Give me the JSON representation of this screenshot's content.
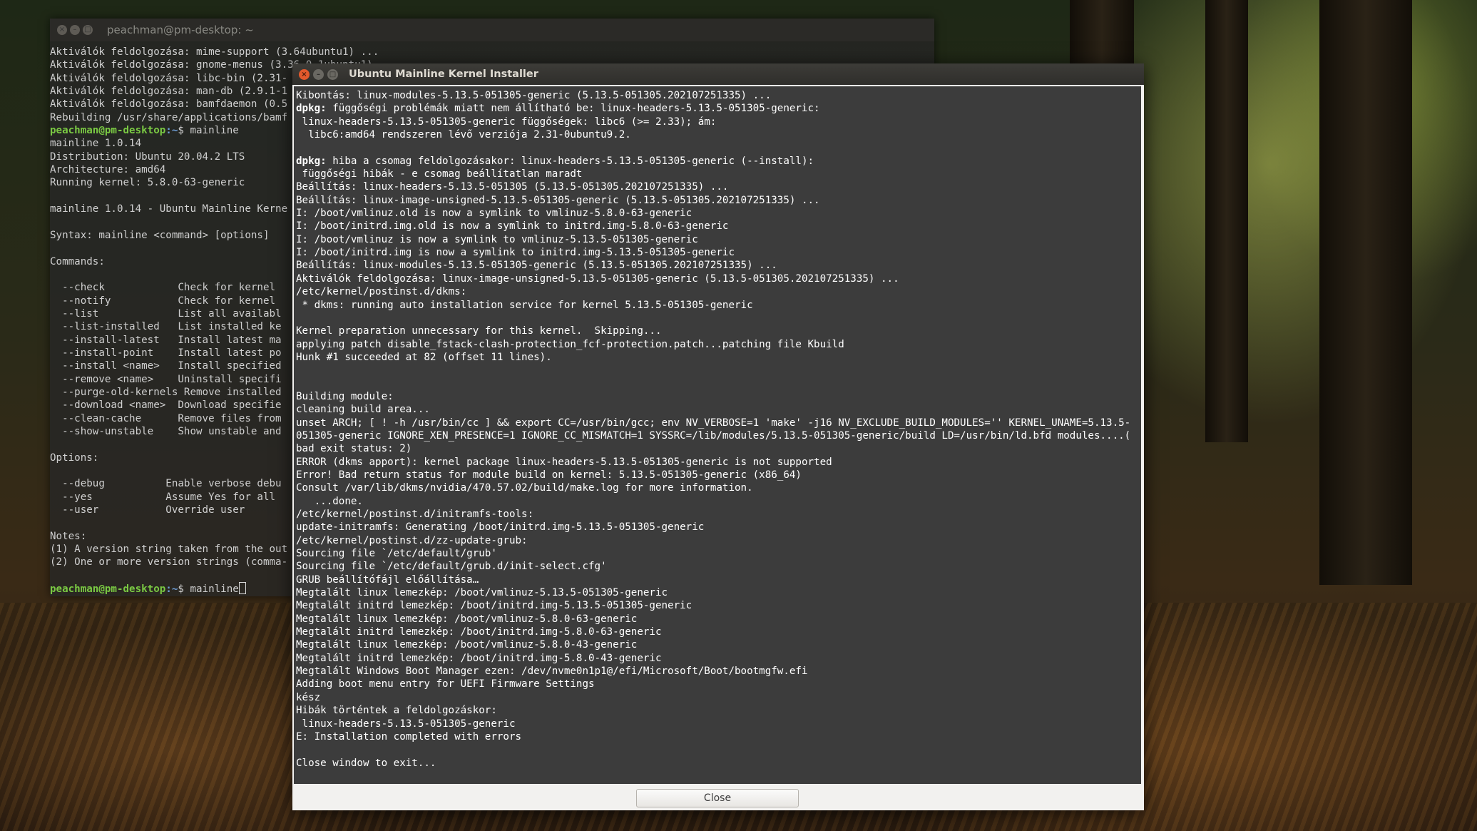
{
  "terminal": {
    "title": "peachman@pm-desktop: ~",
    "lines": [
      {
        "text": "Aktiválók feldolgozása: mime-support (3.64ubuntu1) ..."
      },
      {
        "text": "Aktiválók feldolgozása: gnome-menus (3.36.0-1ubuntu1) ..."
      },
      {
        "text": "Aktiválók feldolgozása: libc-bin (2.31-"
      },
      {
        "text": "Aktiválók feldolgozása: man-db (2.9.1-1"
      },
      {
        "text": "Aktiválók feldolgozása: bamfdaemon (0.5"
      },
      {
        "text": "Rebuilding /usr/share/applications/bamf"
      },
      {
        "user": "peachman@pm-desktop",
        "path": ":~",
        "text": "$ mainline"
      },
      {
        "text": "mainline 1.0.14"
      },
      {
        "text": "Distribution: Ubuntu 20.04.2 LTS"
      },
      {
        "text": "Architecture: amd64"
      },
      {
        "text": "Running kernel: 5.8.0-63-generic"
      },
      {
        "text": ""
      },
      {
        "text": "mainline 1.0.14 - Ubuntu Mainline Kerne"
      },
      {
        "text": ""
      },
      {
        "text": "Syntax: mainline <command> [options]"
      },
      {
        "text": ""
      },
      {
        "text": "Commands:"
      },
      {
        "text": ""
      },
      {
        "text": "  --check            Check for kernel"
      },
      {
        "text": "  --notify           Check for kernel"
      },
      {
        "text": "  --list             List all availabl"
      },
      {
        "text": "  --list-installed   List installed ke"
      },
      {
        "text": "  --install-latest   Install latest ma"
      },
      {
        "text": "  --install-point    Install latest po"
      },
      {
        "text": "  --install <name>   Install specified"
      },
      {
        "text": "  --remove <name>    Uninstall specifi"
      },
      {
        "text": "  --purge-old-kernels Remove installed"
      },
      {
        "text": "  --download <name>  Download specifie"
      },
      {
        "text": "  --clean-cache      Remove files from"
      },
      {
        "text": "  --show-unstable    Show unstable and"
      },
      {
        "text": ""
      },
      {
        "text": "Options:"
      },
      {
        "text": ""
      },
      {
        "text": "  --debug          Enable verbose debu"
      },
      {
        "text": "  --yes            Assume Yes for all"
      },
      {
        "text": "  --user           Override user"
      },
      {
        "text": ""
      },
      {
        "text": "Notes:"
      },
      {
        "text": "(1) A version string taken from the out"
      },
      {
        "text": "(2) One or more version strings (comma-"
      },
      {
        "text": ""
      },
      {
        "user": "peachman@pm-desktop",
        "path": ":~",
        "text": "$ mainline",
        "cursor": true
      }
    ]
  },
  "installer": {
    "title": "Ubuntu Mainline Kernel Installer",
    "close_label": "Close",
    "log": [
      {
        "text": "Kibontás: linux-modules-5.13.5-051305-generic (5.13.5-051305.202107251335) ..."
      },
      {
        "bold": "dpkg:",
        "text": " függőségi problémák miatt nem állítható be: linux-headers-5.13.5-051305-generic:"
      },
      {
        "text": " linux-headers-5.13.5-051305-generic függőségek: libc6 (>= 2.33); ám:"
      },
      {
        "text": "  libc6:amd64 rendszeren lévő verziója 2.31-0ubuntu9.2."
      },
      {
        "text": ""
      },
      {
        "bold": "dpkg:",
        "text": " hiba a csomag feldolgozásakor: linux-headers-5.13.5-051305-generic (--install):"
      },
      {
        "text": " függőségi hibák - e csomag beállítatlan maradt"
      },
      {
        "text": "Beállítás: linux-headers-5.13.5-051305 (5.13.5-051305.202107251335) ..."
      },
      {
        "text": "Beállítás: linux-image-unsigned-5.13.5-051305-generic (5.13.5-051305.202107251335) ..."
      },
      {
        "text": "I: /boot/vmlinuz.old is now a symlink to vmlinuz-5.8.0-63-generic"
      },
      {
        "text": "I: /boot/initrd.img.old is now a symlink to initrd.img-5.8.0-63-generic"
      },
      {
        "text": "I: /boot/vmlinuz is now a symlink to vmlinuz-5.13.5-051305-generic"
      },
      {
        "text": "I: /boot/initrd.img is now a symlink to initrd.img-5.13.5-051305-generic"
      },
      {
        "text": "Beállítás: linux-modules-5.13.5-051305-generic (5.13.5-051305.202107251335) ..."
      },
      {
        "text": "Aktiválók feldolgozása: linux-image-unsigned-5.13.5-051305-generic (5.13.5-051305.202107251335) ..."
      },
      {
        "text": "/etc/kernel/postinst.d/dkms:"
      },
      {
        "text": " * dkms: running auto installation service for kernel 5.13.5-051305-generic"
      },
      {
        "text": ""
      },
      {
        "text": "Kernel preparation unnecessary for this kernel.  Skipping..."
      },
      {
        "text": "applying patch disable_fstack-clash-protection_fcf-protection.patch...patching file Kbuild"
      },
      {
        "text": "Hunk #1 succeeded at 82 (offset 11 lines)."
      },
      {
        "text": ""
      },
      {
        "text": ""
      },
      {
        "text": "Building module:"
      },
      {
        "text": "cleaning build area..."
      },
      {
        "text": "unset ARCH; [ ! -h /usr/bin/cc ] && export CC=/usr/bin/gcc; env NV_VERBOSE=1 'make' -j16 NV_EXCLUDE_BUILD_MODULES='' KERNEL_UNAME=5.13.5-"
      },
      {
        "text": "051305-generic IGNORE_XEN_PRESENCE=1 IGNORE_CC_MISMATCH=1 SYSSRC=/lib/modules/5.13.5-051305-generic/build LD=/usr/bin/ld.bfd modules....("
      },
      {
        "text": "bad exit status: 2)"
      },
      {
        "text": "ERROR (dkms apport): kernel package linux-headers-5.13.5-051305-generic is not supported"
      },
      {
        "text": "Error! Bad return status for module build on kernel: 5.13.5-051305-generic (x86_64)"
      },
      {
        "text": "Consult /var/lib/dkms/nvidia/470.57.02/build/make.log for more information."
      },
      {
        "text": "   ...done."
      },
      {
        "text": "/etc/kernel/postinst.d/initramfs-tools:"
      },
      {
        "text": "update-initramfs: Generating /boot/initrd.img-5.13.5-051305-generic"
      },
      {
        "text": "/etc/kernel/postinst.d/zz-update-grub:"
      },
      {
        "text": "Sourcing file `/etc/default/grub'"
      },
      {
        "text": "Sourcing file `/etc/default/grub.d/init-select.cfg'"
      },
      {
        "text": "GRUB beállítófájl előállítása…"
      },
      {
        "text": "Megtalált linux lemezkép: /boot/vmlinuz-5.13.5-051305-generic"
      },
      {
        "text": "Megtalált initrd lemezkép: /boot/initrd.img-5.13.5-051305-generic"
      },
      {
        "text": "Megtalált linux lemezkép: /boot/vmlinuz-5.8.0-63-generic"
      },
      {
        "text": "Megtalált initrd lemezkép: /boot/initrd.img-5.8.0-63-generic"
      },
      {
        "text": "Megtalált linux lemezkép: /boot/vmlinuz-5.8.0-43-generic"
      },
      {
        "text": "Megtalált initrd lemezkép: /boot/initrd.img-5.8.0-43-generic"
      },
      {
        "text": "Megtalált Windows Boot Manager ezen: /dev/nvme0n1p1@/efi/Microsoft/Boot/bootmgfw.efi"
      },
      {
        "text": "Adding boot menu entry for UEFI Firmware Settings"
      },
      {
        "text": "kész"
      },
      {
        "text": "Hibák történtek a feldolgozáskor:"
      },
      {
        "text": " linux-headers-5.13.5-051305-generic"
      },
      {
        "text": "E: Installation completed with errors"
      },
      {
        "text": ""
      },
      {
        "text": "Close window to exit..."
      },
      {
        "text": "_"
      }
    ]
  }
}
